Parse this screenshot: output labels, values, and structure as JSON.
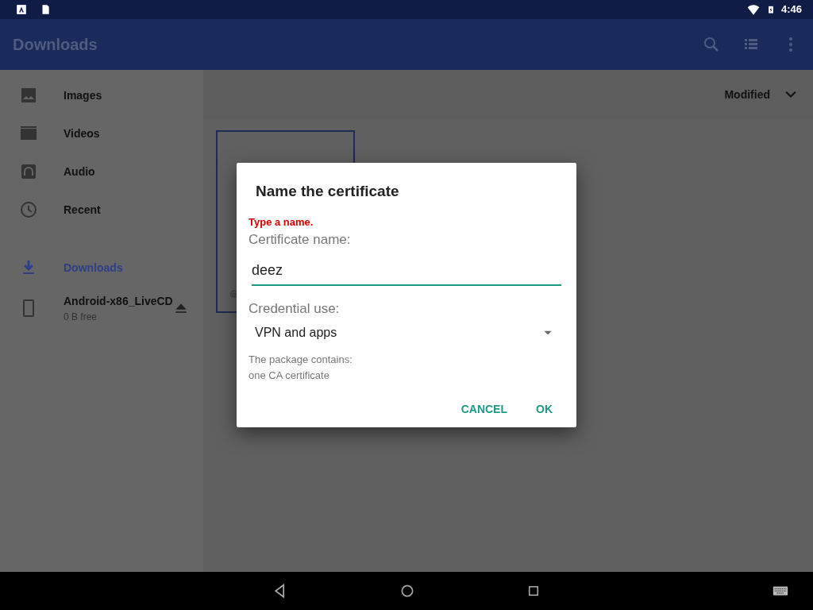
{
  "status_bar": {
    "time": "4:46"
  },
  "app_bar": {
    "title": "Downloads"
  },
  "sidebar": {
    "sections": [
      [
        {
          "kind": "image",
          "label": "Images",
          "selected": false
        },
        {
          "kind": "video",
          "label": "Videos",
          "selected": false
        },
        {
          "kind": "audio",
          "label": "Audio",
          "selected": false
        },
        {
          "kind": "recent",
          "label": "Recent",
          "selected": false
        }
      ],
      [
        {
          "kind": "download",
          "label": "Downloads",
          "selected": true
        },
        {
          "kind": "device",
          "label": "Android-x86_LiveCD",
          "subtitle": "0 B free",
          "selected": false
        }
      ]
    ]
  },
  "sort": {
    "label": "Modified"
  },
  "dialog": {
    "title": "Name the certificate",
    "error": "Type a name.",
    "name_label": "Certificate name:",
    "name_value": "deez",
    "use_label": "Credential use:",
    "use_value": "VPN and apps",
    "info": [
      "The package contains:",
      "one CA certificate"
    ],
    "buttons": [
      "CANCEL",
      "OK"
    ]
  }
}
